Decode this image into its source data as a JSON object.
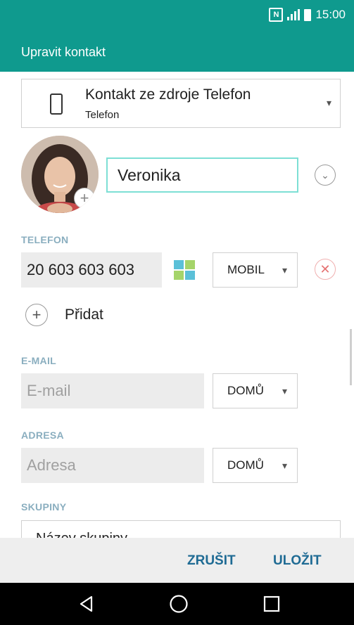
{
  "status_bar": {
    "time": "15:00",
    "nfc_label": "N"
  },
  "app_bar": {
    "title": "Upravit kontakt"
  },
  "account_source": {
    "title": "Kontakt ze zdroje Telefon",
    "subtitle": "Telefon"
  },
  "contact": {
    "name": "Veronika"
  },
  "sections": {
    "phone": {
      "label": "TELEFON",
      "value": "20 603 603 603",
      "type": "MOBIL",
      "add_label": "Přidat"
    },
    "email": {
      "label": "E-MAIL",
      "placeholder": "E-mail",
      "type": "DOMŮ"
    },
    "address": {
      "label": "ADRESA",
      "placeholder": "Adresa",
      "type": "DOMŮ"
    },
    "groups": {
      "label": "SKUPINY",
      "placeholder": "Název skupiny"
    }
  },
  "actions": {
    "cancel": "ZRUŠIT",
    "save": "ULOŽIT"
  },
  "colors": {
    "accent": "#0f9a8e",
    "action_text": "#1f6b94",
    "label": "#8aaebf",
    "remove": "#e57373"
  }
}
